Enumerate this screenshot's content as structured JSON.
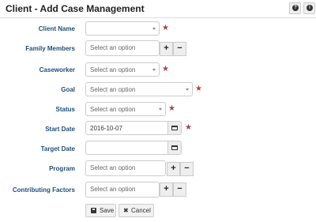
{
  "header": {
    "title": "Client - Add Case Management",
    "help_icon_glyph": "?",
    "info_icon_glyph": "i"
  },
  "form": {
    "client_name": {
      "label": "Client Name",
      "value": "",
      "required": true
    },
    "family_members": {
      "label": "Family Members",
      "placeholder": "Select an option"
    },
    "caseworker": {
      "label": "Caseworker",
      "placeholder": "Select an option",
      "required": true
    },
    "goal": {
      "label": "Goal",
      "placeholder": "Select an option",
      "required": true
    },
    "status": {
      "label": "Status",
      "placeholder": "Select an option",
      "required": true
    },
    "start_date": {
      "label": "Start Date",
      "value": "2016-10-07",
      "required": true
    },
    "target_date": {
      "label": "Target Date",
      "value": ""
    },
    "program": {
      "label": "Program",
      "placeholder": "Select an option"
    },
    "contributing_factors": {
      "label": "Contributing Factors",
      "placeholder": "Select an option"
    }
  },
  "controls": {
    "add_symbol": "+",
    "remove_symbol": "−",
    "required_marker": "★"
  },
  "actions": {
    "save_label": "Save",
    "cancel_label": "Cancel",
    "cancel_icon": "✖"
  },
  "colors": {
    "label": "#1f4e79",
    "required_star": "#a94442",
    "button_bg": "#eeeeee",
    "border": "#cccccc"
  },
  "icons": [
    "help-icon",
    "info-icon",
    "caret-down-icon",
    "calendar-icon",
    "plus-icon",
    "minus-icon",
    "save-icon",
    "cancel-icon"
  ]
}
